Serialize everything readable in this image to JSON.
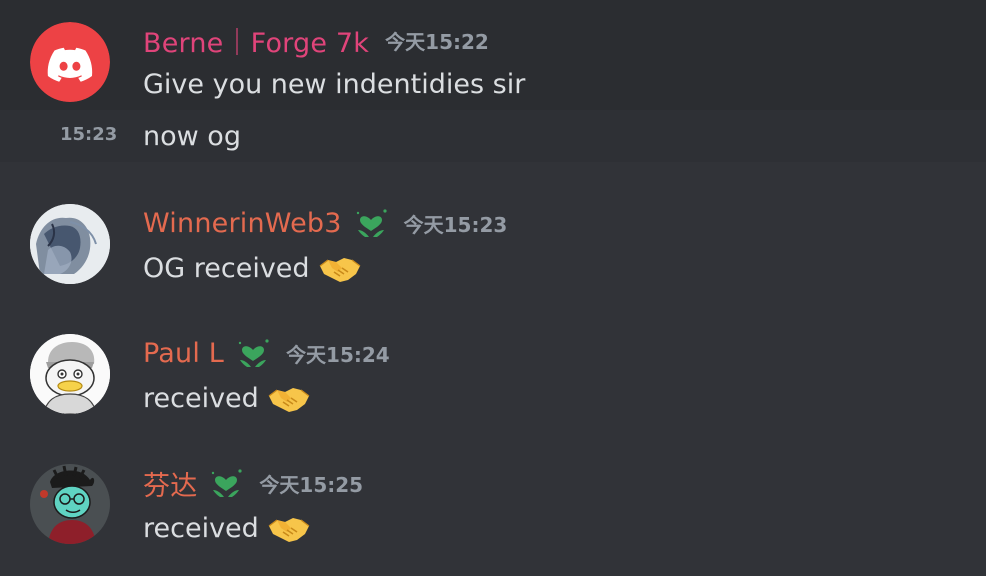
{
  "messages": [
    {
      "username": "Berne｜Forge 7k",
      "name_color": "#e0447a",
      "timestamp": "今天15:22",
      "text": "Give you new indentidies sir",
      "avatar": "discord-logo-avatar",
      "followups": [
        {
          "time": "15:23",
          "text": "now og"
        }
      ]
    },
    {
      "username": "WinnerinWeb3",
      "name_color": "#e46a4f",
      "role_icon": "green-heart-plant-icon",
      "timestamp": "今天15:23",
      "text": "OG received",
      "emoji": "handshake-icon",
      "avatar": "sketch-avatar"
    },
    {
      "username": "Paul L",
      "name_color": "#e46a4f",
      "role_icon": "green-heart-plant-icon",
      "timestamp": "今天15:24",
      "text": "received",
      "emoji": "handshake-icon",
      "avatar": "duck-avatar"
    },
    {
      "username": "芬达",
      "name_color": "#e46a4f",
      "role_icon": "green-heart-plant-icon",
      "timestamp": "今天15:25",
      "text": "received",
      "emoji": "handshake-icon",
      "avatar": "cartoon-avatar"
    }
  ],
  "colors": {
    "background": "#313338",
    "hover_background": "#2b2d31",
    "text": "#dbdee1",
    "muted": "#949ba4",
    "role_green": "#3ba55d"
  }
}
